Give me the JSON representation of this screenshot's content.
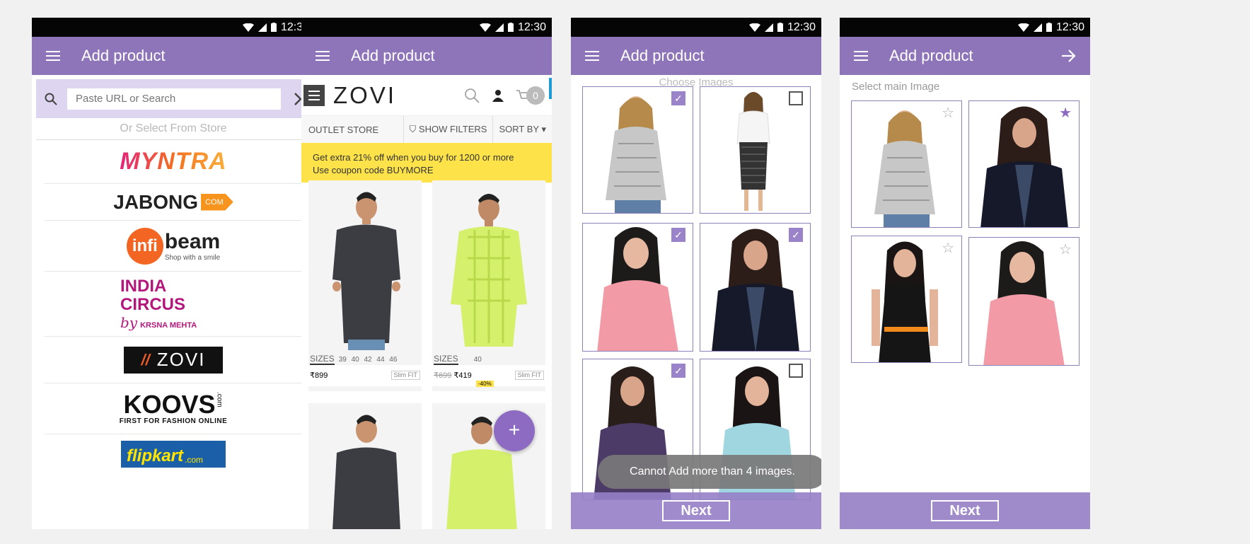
{
  "status_time": "12:30",
  "screen1": {
    "title": "Add product",
    "search_placeholder": "Paste URL or Search",
    "hint": "Or Select From Store",
    "stores": [
      "MYNTRA",
      "JABONG",
      "infibeam",
      "INDIA CIRCUS",
      "ZOVI",
      "KOOVS",
      "flipkart"
    ],
    "jabong_badge": "COM",
    "infibeam_tagline": "Shop with a smile",
    "india_circus_by": "by",
    "india_circus_sub": "KRSNA MEHTA",
    "koovs_sub": "FIRST FOR FASHION ONLINE",
    "koovs_com": ".com",
    "flipkart_com": ".com"
  },
  "screen2": {
    "title": "Add product",
    "brand": "ZOVI",
    "cart_count": "0",
    "outlet": "OUTLET STORE",
    "show_filters": "SHOW FILTERS",
    "sort_by": "SORT BY",
    "promo_line1": "Get extra 21% off when you buy for 1200 or more",
    "promo_line2": "Use coupon code BUYMORE",
    "sizes_label": "SIZES",
    "sizes_left": "39 40 42 44 46",
    "sizes_right": "40",
    "price_left": "₹899",
    "price_right_old": "₹699",
    "price_right": "₹419",
    "discount": "-40%",
    "fit": "Slim FIT",
    "fab": "+"
  },
  "screen3": {
    "title": "Add product",
    "subtitle": "Choose Images",
    "toast": "Cannot Add more than 4 images.",
    "next": "Next"
  },
  "screen4": {
    "title": "Add product",
    "subtitle": "Select main Image",
    "next": "Next"
  },
  "colors": {
    "appbar": "#8e75ba",
    "accent": "#9a83c9",
    "promo": "#fde24a"
  }
}
